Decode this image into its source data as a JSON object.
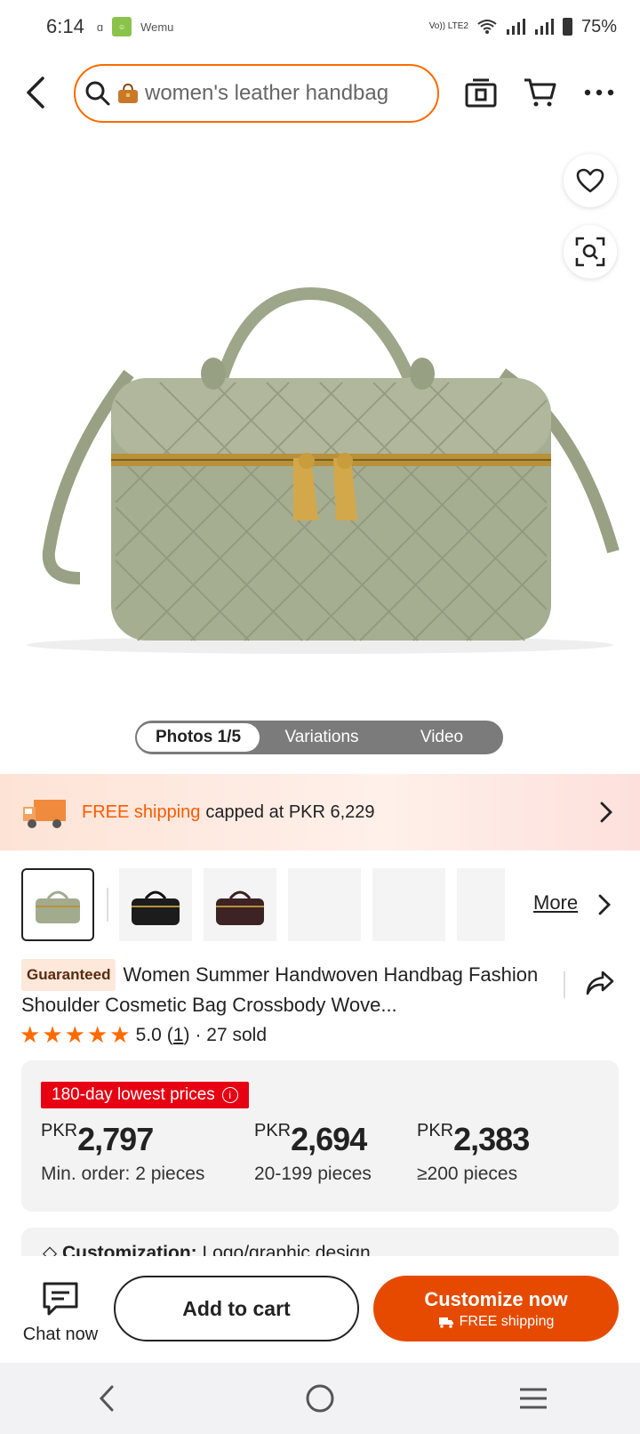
{
  "status_bar": {
    "time": "6:14",
    "carrier_label": "Wemu",
    "network": "Vo)) LTE2",
    "battery": "75%"
  },
  "search": {
    "query": "women's leather handbag"
  },
  "hero": {
    "tabs": [
      "Photos 1/5",
      "Variations",
      "Video"
    ]
  },
  "shipping_banner": {
    "highlight": "FREE shipping",
    "text": "capped at PKR 6,229"
  },
  "thumbnails": {
    "more_label": "More"
  },
  "product": {
    "badge": "Guaranteed",
    "title": "Women Summer Handwoven Handbag Fashion Shoulder Cosmetic Bag Crossbody Wove...",
    "rating_value": "5.0",
    "rating_count": "1",
    "sold": "· 27 sold",
    "stars": 5
  },
  "pricing": {
    "tag": "180-day lowest prices",
    "tiers": [
      {
        "currency": "PKR",
        "amount": "2,797",
        "condition": "Min. order: 2 pieces"
      },
      {
        "currency": "PKR",
        "amount": "2,694",
        "condition": "20-199 pieces"
      },
      {
        "currency": "PKR",
        "amount": "2,383",
        "condition": "≥200 pieces"
      }
    ]
  },
  "customization": {
    "label": "Customization:",
    "value": "Logo/graphic design"
  },
  "actions": {
    "chat": "Chat now",
    "add_to_cart": "Add to cart",
    "customize": "Customize now",
    "customize_sub": "FREE shipping"
  },
  "colors": {
    "accent": "#ff6a00",
    "cta": "#e64a00",
    "tag_red": "#e60012",
    "bag_green": "#a3ab8e"
  }
}
